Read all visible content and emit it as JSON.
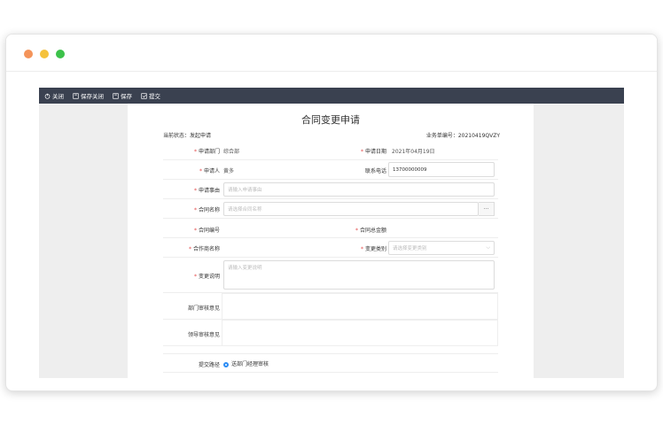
{
  "toolbar": {
    "close": "关闭",
    "save_close": "保存关闭",
    "save": "保存",
    "submit": "提交"
  },
  "form": {
    "title": "合同变更申请",
    "status_label": "当前状态：",
    "status_value": "发起申请",
    "biz_no_label": "业务单编号：",
    "biz_no_value": "20210419QVZY",
    "dept_label": "申请部门",
    "dept_value": "综合部",
    "date_label": "申请日期",
    "date_value": "2021年04月19日",
    "applicant_label": "申请人",
    "applicant_value": "黄多",
    "phone_label": "联系电话",
    "phone_value": "13700000009",
    "reason_label": "申请事由",
    "reason_placeholder": "请输入申请事由",
    "contract_name_label": "合同名称",
    "contract_name_placeholder": "请选择合同名称",
    "contract_name_button": "···",
    "contract_no_label": "合同编号",
    "contract_total_label": "合同总金额",
    "partner_label": "合作商名称",
    "change_type_label": "变更类别",
    "change_type_placeholder": "请选择变更类别",
    "change_desc_label": "变更说明",
    "change_desc_placeholder": "请输入变更说明",
    "dept_review_label": "部门审核意见",
    "leader_review_label": "领导审核意见",
    "route_label": "提交路径",
    "route_option": "送部门经理审核"
  },
  "colors": {
    "toolbar_bg": "#3a4150",
    "required": "#e34a4a",
    "radio": "#2c8cf4"
  }
}
